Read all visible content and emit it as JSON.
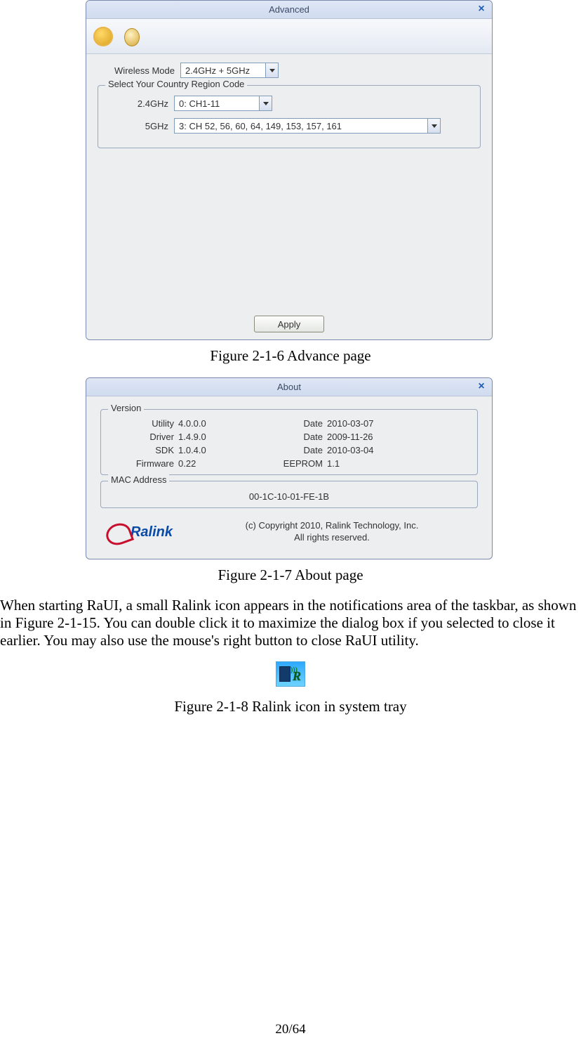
{
  "advanced": {
    "title": "Advanced",
    "close": "×",
    "wireless_mode_label": "Wireless Mode",
    "wireless_mode_value": "2.4GHz + 5GHz",
    "region_group_label": "Select Your Country Region Code",
    "band24_label": "2.4GHz",
    "band24_value": "0: CH1-11",
    "band5_label": "5GHz",
    "band5_value": "3:   CH  52,   56,   60,   64, 149, 153, 157, 161",
    "apply_label": "Apply"
  },
  "fig1_caption": "Figure 2-1-6 Advance page",
  "about": {
    "title": "About",
    "close": "×",
    "version_label": "Version",
    "rows": [
      {
        "l1": "Utility",
        "v1": "4.0.0.0",
        "l2": "Date",
        "v2": "2010-03-07"
      },
      {
        "l1": "Driver",
        "v1": "1.4.9.0",
        "l2": "Date",
        "v2": "2009-11-26"
      },
      {
        "l1": "SDK",
        "v1": "1.0.4.0",
        "l2": "Date",
        "v2": "2010-03-04"
      },
      {
        "l1": "Firmware",
        "v1": "0.22",
        "l2": "EEPROM",
        "v2": "1.1"
      }
    ],
    "mac_label": "MAC Address",
    "mac_value": "00-1C-10-01-FE-1B",
    "logo_text": "Ralink",
    "copyright_line1": "(c) Copyright 2010, Ralink Technology, Inc.",
    "copyright_line2": "All rights reserved."
  },
  "fig2_caption": "Figure 2-1-7 About page",
  "paragraph": "When starting RaUI, a small Ralink icon appears in the notifications area of the taskbar, as shown in Figure 2-1-15. You can double click it to maximize the dialog box if you selected to close it earlier. You may also use the mouse's right button to close RaUI utility.",
  "fig3_caption": "Figure 2-1-8 Ralink icon in system tray",
  "tray_r": "R",
  "tray_sig": ")))",
  "page_number": "20/64"
}
